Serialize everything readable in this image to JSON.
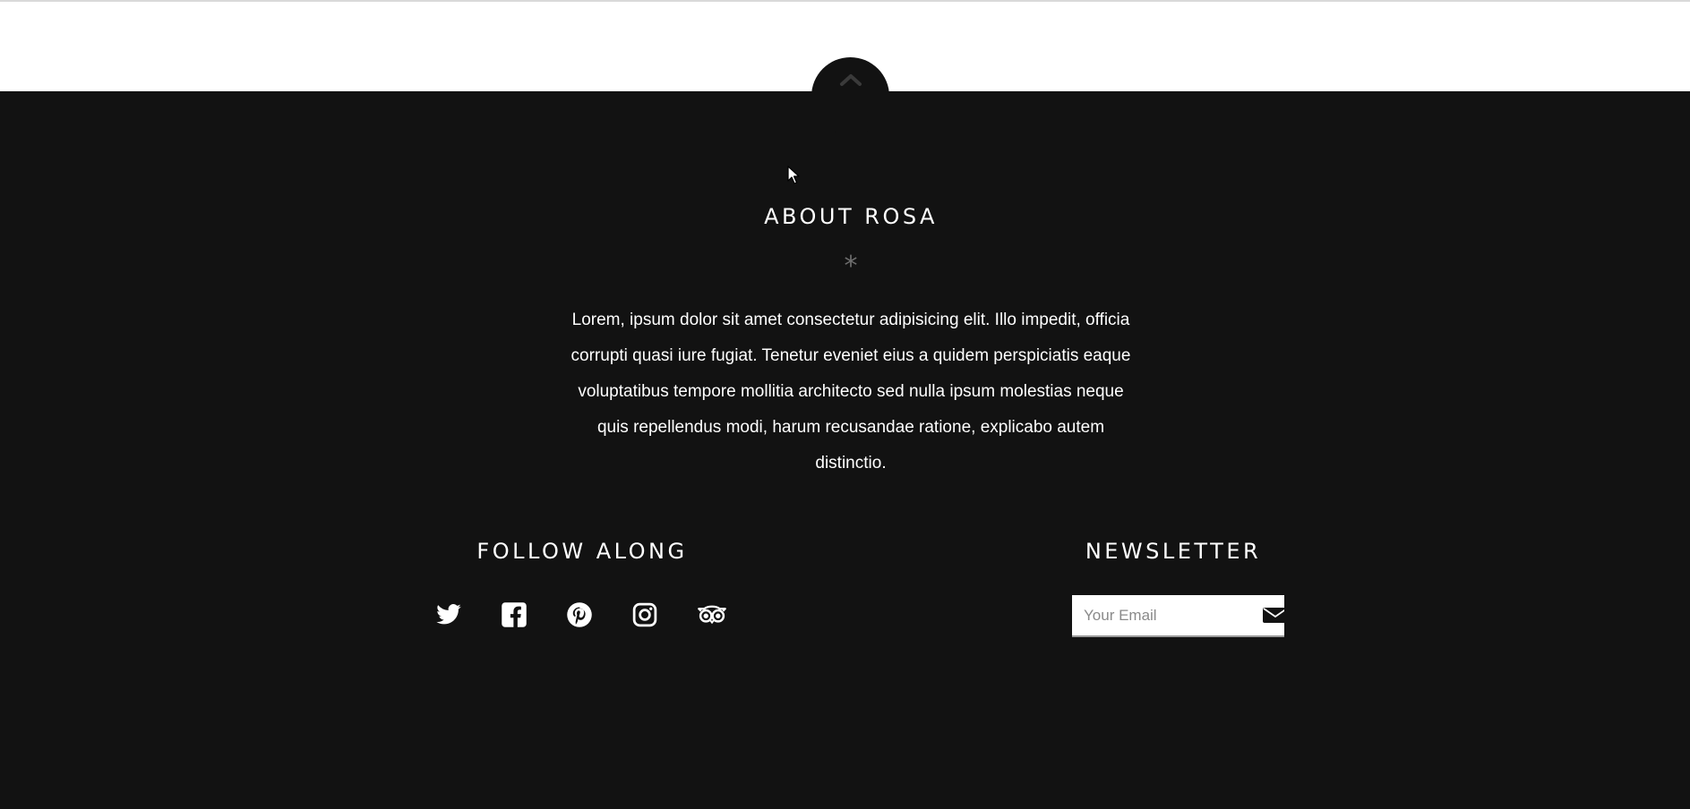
{
  "back_to_top": {
    "icon": "chevron-up-icon"
  },
  "about": {
    "title": "ABOUT ROSA",
    "divider": "*",
    "body": "Lorem, ipsum dolor sit amet consectetur adipisicing elit. Illo impedit, officia corrupti quasi iure fugiat. Tenetur eveniet eius a quidem perspiciatis eaque voluptatibus tempore mollitia architecto sed nulla ipsum molestias neque quis repellendus modi, harum recusandae ratione, explicabo autem distinctio."
  },
  "follow": {
    "title": "FOLLOW ALONG",
    "icons": [
      "twitter-icon",
      "facebook-icon",
      "pinterest-icon",
      "instagram-icon",
      "tripadvisor-icon"
    ]
  },
  "newsletter": {
    "title": "NEWSLETTER",
    "placeholder": "Your Email",
    "submit_icon": "envelope-icon"
  },
  "colors": {
    "footer_bg": "#121212",
    "text": "#ffffff",
    "divider": "#6e6e6e"
  }
}
